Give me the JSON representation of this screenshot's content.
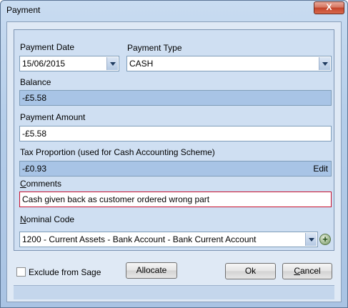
{
  "window": {
    "title": "Payment",
    "close_glyph": "X"
  },
  "form": {
    "payment_date": {
      "label": "Payment Date",
      "value": "15/06/2015"
    },
    "payment_type": {
      "label": "Payment Type",
      "value": "CASH"
    },
    "balance": {
      "label": "Balance",
      "value": "-£5.58"
    },
    "payment_amount": {
      "label": "Payment Amount",
      "value": "-£5.58"
    },
    "tax_proportion": {
      "label": "Tax Proportion (used for Cash Accounting Scheme)",
      "value": "-£0.93",
      "edit_label": "Edit"
    },
    "comments": {
      "label_first": "C",
      "label_rest": "omments",
      "value": "Cash given back as customer ordered wrong part"
    },
    "nominal_code": {
      "label_first": "N",
      "label_rest": "ominal Code",
      "value": "1200 - Current Assets - Bank Account - Bank Current Account",
      "add_glyph": "+"
    }
  },
  "footer": {
    "exclude_label": "Exclude from Sage",
    "exclude_checked": false,
    "allocate_label": "Allocate",
    "ok_label": "Ok",
    "cancel_first": "C",
    "cancel_rest": "ancel"
  },
  "colors": {
    "readonly_bg": "#a8c4e6",
    "error_border": "#c8102e",
    "panel_bg": "#cfdff2"
  },
  "icons": [
    "close-icon",
    "chevron-down-icon",
    "plus-icon"
  ]
}
